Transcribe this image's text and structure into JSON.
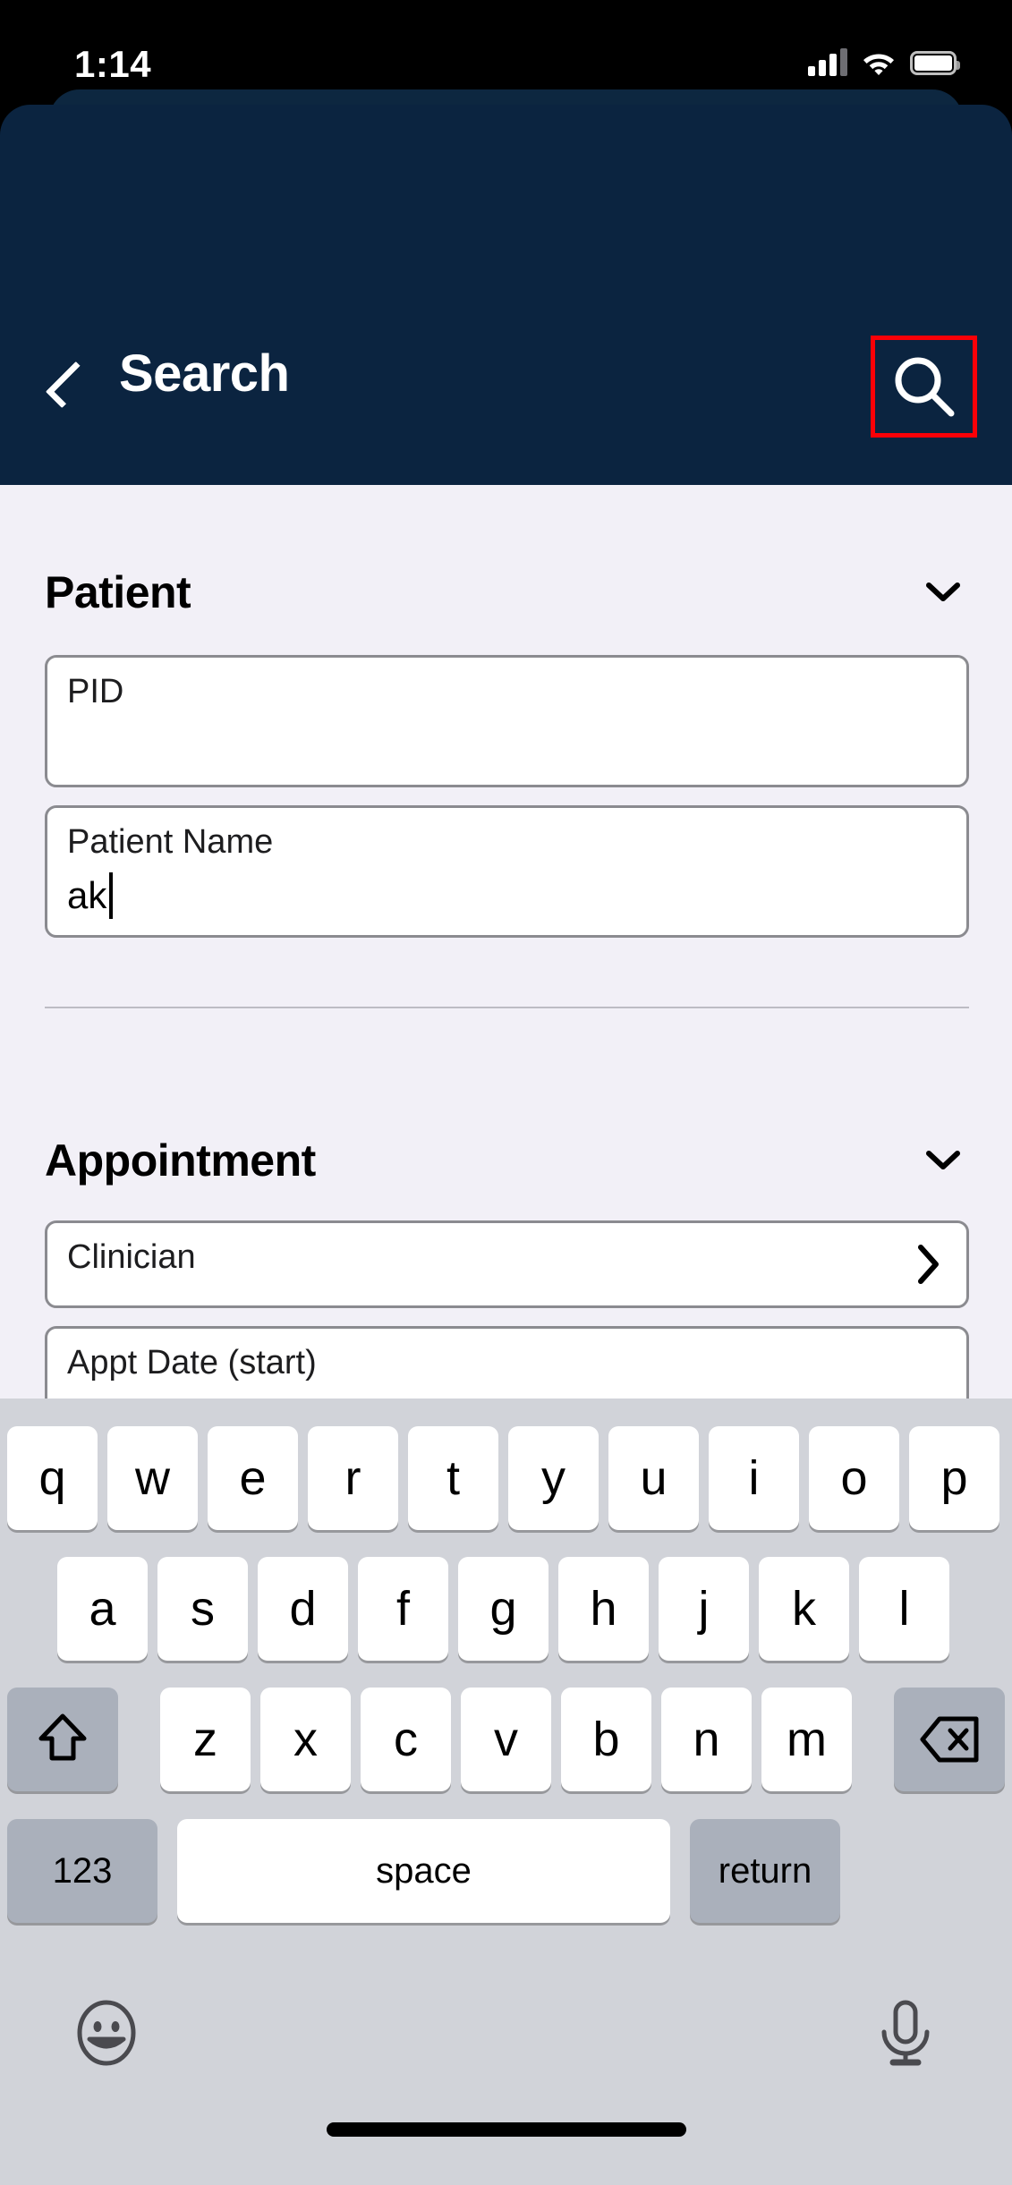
{
  "status_bar": {
    "time": "1:14",
    "icons": [
      "cellular-signal-icon",
      "wifi-icon",
      "battery-icon"
    ]
  },
  "header": {
    "title": "Search",
    "back_icon": "chevron-left-icon",
    "search_icon": "search-icon",
    "background_color": "#0b2440",
    "highlight_color": "#fb0007"
  },
  "sections": [
    {
      "title": "Patient",
      "collapse_icon": "chevron-down-icon",
      "fields": [
        {
          "label": "PID",
          "value": "",
          "type": "text"
        },
        {
          "label": "Patient Name",
          "value": "ak",
          "type": "text",
          "focused": true
        }
      ]
    },
    {
      "title": "Appointment",
      "collapse_icon": "chevron-down-icon",
      "fields": [
        {
          "label": "Clinician",
          "value": "",
          "type": "picker",
          "accessory_icon": "chevron-right-icon"
        },
        {
          "label": "Appt Date (start)",
          "value": "",
          "type": "text"
        }
      ]
    }
  ],
  "keyboard": {
    "row1": [
      "q",
      "w",
      "e",
      "r",
      "t",
      "y",
      "u",
      "i",
      "o",
      "p"
    ],
    "row2": [
      "a",
      "s",
      "d",
      "f",
      "g",
      "h",
      "j",
      "k",
      "l"
    ],
    "row3": [
      "z",
      "x",
      "c",
      "v",
      "b",
      "n",
      "m"
    ],
    "shift_icon": "shift-arrow-icon",
    "backspace_icon": "backspace-icon",
    "numbers_key": "123",
    "space_key": "space",
    "return_key": "return",
    "emoji_icon": "emoji-smiley-icon",
    "dictation_icon": "microphone-icon",
    "background_color": "#d1d3d9"
  },
  "content": {
    "background_color": "#f2f0f7"
  }
}
